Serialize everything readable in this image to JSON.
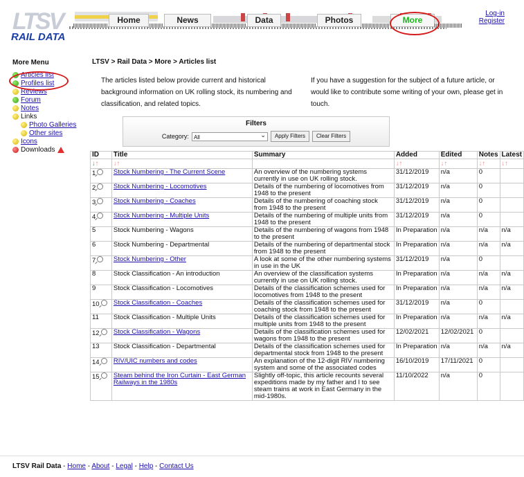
{
  "header": {
    "logo_top": "LTSV",
    "logo_bottom": "RAIL DATA",
    "nav": [
      "Home",
      "News",
      "Data",
      "Photos",
      "More"
    ],
    "login": "Log-in",
    "register": "Register"
  },
  "sidebar": {
    "title": "More Menu",
    "items": [
      {
        "label": "Articles list",
        "color": "green"
      },
      {
        "label": "Profiles list",
        "color": "green"
      },
      {
        "label": "Reviews",
        "color": "yellow"
      },
      {
        "label": "Forum",
        "color": "green"
      },
      {
        "label": "Notes",
        "color": "yellow"
      },
      {
        "label": "Links",
        "color": "yellow"
      },
      {
        "label": "Photo Galleries",
        "color": "yellow"
      },
      {
        "label": "Other sites",
        "color": "yellow"
      },
      {
        "label": "Icons",
        "color": "yellow"
      },
      {
        "label": "Downloads",
        "color": "red"
      }
    ]
  },
  "breadcrumb": "LTSV > Rail Data > More > Articles list",
  "intro_left": "The articles listed below provide current and historical background information on UK rolling stock, its numbering and classification, and related topics.",
  "intro_right": "If you have a suggestion for the subject of a future article, or would like to contribute some writing of your own, please get in touch.",
  "filters": {
    "title": "Filters",
    "category_label": "Category:",
    "category_value": "All",
    "apply": "Apply Filters",
    "clear": "Clear Filters"
  },
  "table": {
    "headers": [
      "ID",
      "Title",
      "Summary",
      "Added",
      "Edited",
      "Notes",
      "Latest"
    ],
    "rows": [
      {
        "id": "1",
        "title": "Stock Numbering - The Current Scene",
        "link": true,
        "summary": "An overview of the numbering systems currently in use on UK rolling stock.",
        "added": "31/12/2019",
        "edited": "n/a",
        "notes": "0",
        "latest": ""
      },
      {
        "id": "2",
        "title": "Stock Numbering - Locomotives",
        "link": true,
        "summary": "Details of the numbering of locomotives from 1948 to the present",
        "added": "31/12/2019",
        "edited": "n/a",
        "notes": "0",
        "latest": ""
      },
      {
        "id": "3",
        "title": "Stock Numbering - Coaches",
        "link": true,
        "summary": "Details of the numbering of coaching stock from 1948 to the present",
        "added": "31/12/2019",
        "edited": "n/a",
        "notes": "0",
        "latest": ""
      },
      {
        "id": "4",
        "title": "Stock Numbering - Multiple Units",
        "link": true,
        "summary": "Details of the numbering of multiple units from 1948 to the present",
        "added": "31/12/2019",
        "edited": "n/a",
        "notes": "0",
        "latest": ""
      },
      {
        "id": "5",
        "title": "Stock Numbering - Wagons",
        "link": false,
        "summary": "Details of the numbering of wagons from 1948 to the present",
        "added": "In Preparation",
        "edited": "n/a",
        "notes": "n/a",
        "latest": "n/a"
      },
      {
        "id": "6",
        "title": "Stock Numbering - Departmental",
        "link": false,
        "summary": "Details of the numbering of departmental stock from 1948 to the present",
        "added": "In Preparation",
        "edited": "n/a",
        "notes": "n/a",
        "latest": "n/a"
      },
      {
        "id": "7",
        "title": "Stock Numbering - Other",
        "link": true,
        "summary": "A look at some of the other numbering systems in use in the UK",
        "added": "31/12/2019",
        "edited": "n/a",
        "notes": "0",
        "latest": ""
      },
      {
        "id": "8",
        "title": "Stock Classification - An introduction",
        "link": false,
        "summary": "An overview of the classification systems currently in use on UK rolling stock.",
        "added": "In Preparation",
        "edited": "n/a",
        "notes": "n/a",
        "latest": "n/a"
      },
      {
        "id": "9",
        "title": "Stock Classification - Locomotives",
        "link": false,
        "summary": "Details of the classification schemes used for locomotives from 1948 to the present",
        "added": "In Preparation",
        "edited": "n/a",
        "notes": "n/a",
        "latest": "n/a"
      },
      {
        "id": "10",
        "title": "Stock Classification - Coaches",
        "link": true,
        "summary": "Details of the classification schemes used for coaching stock from 1948 to the present",
        "added": "31/12/2019",
        "edited": "n/a",
        "notes": "0",
        "latest": ""
      },
      {
        "id": "11",
        "title": "Stock Classification - Multiple Units",
        "link": false,
        "summary": "Details of the classification schemes used for multiple units from 1948 to the present",
        "added": "In Preparation",
        "edited": "n/a",
        "notes": "n/a",
        "latest": "n/a"
      },
      {
        "id": "12",
        "title": "Stock Classification - Wagons",
        "link": true,
        "summary": "Details of the classification schemes used for wagons from 1948 to the present",
        "added": "12/02/2021",
        "edited": "12/02/2021",
        "notes": "0",
        "latest": ""
      },
      {
        "id": "13",
        "title": "Stock Classification - Departmental",
        "link": false,
        "summary": "Details of the classification schemes used for departmental stock from 1948 to the present",
        "added": "In Preparation",
        "edited": "n/a",
        "notes": "n/a",
        "latest": "n/a"
      },
      {
        "id": "14",
        "title": "RIV/UIC numbers and codes",
        "link": true,
        "summary": "An explanation of the 12-digit RIV numbering system and some of the associated codes",
        "added": "16/10/2019",
        "edited": "17/11/2021",
        "notes": "0",
        "latest": ""
      },
      {
        "id": "15",
        "title": "Steam behind the Iron Curtain - East German Railways in the 1980s",
        "link": true,
        "summary": "Slightly off-topic, this article recounts several expeditions made by my father and I to see steam trains at work in East Germany in the mid-1980s.",
        "added": "11/10/2022",
        "edited": "n/a",
        "notes": "0",
        "latest": ""
      }
    ]
  },
  "footer": {
    "site": "LTSV Rail Data",
    "links": [
      "Home",
      "About",
      "Legal",
      "Help",
      "Contact Us"
    ]
  },
  "colors": {
    "link": "#1a0dab",
    "more_active": "#18b818",
    "logo_blue": "#1a3ea8",
    "highlight_red": "#d51a1a"
  }
}
